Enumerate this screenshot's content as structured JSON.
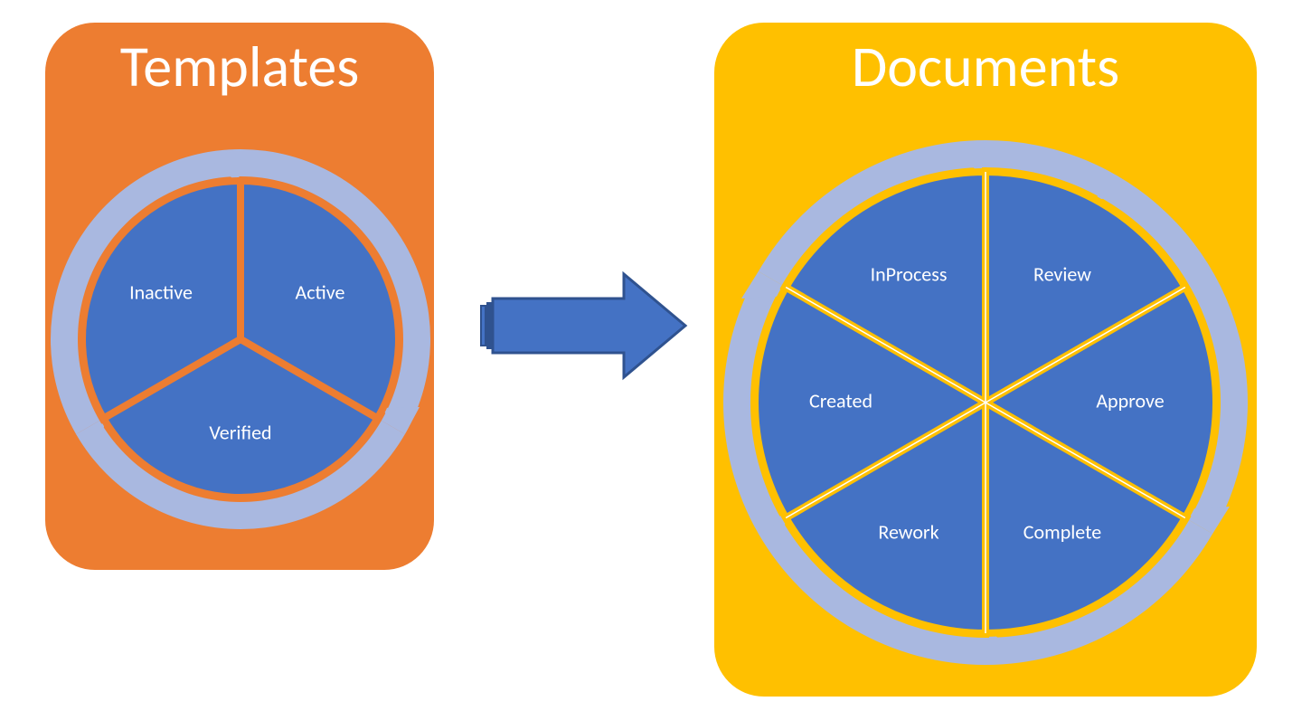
{
  "templates": {
    "title": "Templates",
    "segments": [
      "Inactive",
      "Active",
      "Verified"
    ]
  },
  "documents": {
    "title": "Documents",
    "segments": [
      "InProcess",
      "Review",
      "Approve",
      "Complete",
      "Rework",
      "Created"
    ]
  },
  "colors": {
    "templates_bg": "#ED7D31",
    "documents_bg": "#FFC000",
    "wheel_fill": "#4472C4",
    "ring_arrow": "#A9B8E0",
    "connector_fill": "#4472C4",
    "connector_stroke": "#2F528F"
  },
  "chart_data": [
    {
      "type": "pie",
      "title": "Templates",
      "categories": [
        "Inactive",
        "Active",
        "Verified"
      ],
      "values": [
        1,
        1,
        1
      ]
    },
    {
      "type": "pie",
      "title": "Documents",
      "categories": [
        "InProcess",
        "Review",
        "Approve",
        "Complete",
        "Rework",
        "Created"
      ],
      "values": [
        1,
        1,
        1,
        1,
        1,
        1
      ]
    }
  ]
}
